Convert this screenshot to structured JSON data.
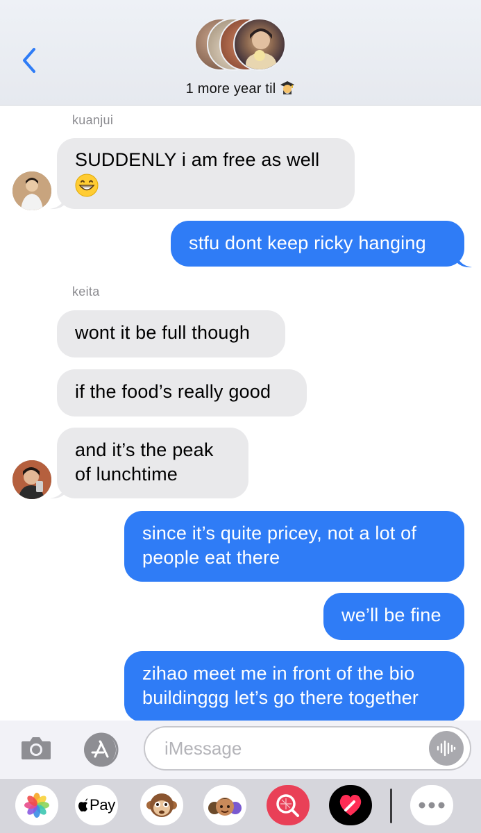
{
  "header": {
    "back_icon": "chevron-left-icon",
    "group_name": "1 more year til",
    "group_emoji": "student-emoji"
  },
  "messages": [
    {
      "sender": "kuanjui",
      "lines": [
        "SUDDENLY i am free as well",
        "😁"
      ],
      "direction": "incoming"
    },
    {
      "lines": [
        "stfu dont keep ricky hanging"
      ],
      "direction": "outgoing"
    },
    {
      "sender": "keita",
      "lines": [
        "wont it be full though"
      ],
      "direction": "incoming"
    },
    {
      "lines": [
        "if the food’s really good"
      ],
      "direction": "incoming"
    },
    {
      "lines": [
        "and it’s the peak",
        "of lunchtime"
      ],
      "direction": "incoming"
    },
    {
      "lines": [
        "since it’s quite pricey, not a lot of",
        "people eat there"
      ],
      "direction": "outgoing"
    },
    {
      "lines": [
        "we’ll be fine"
      ],
      "direction": "outgoing"
    },
    {
      "lines": [
        "zihao meet me in front of the bio",
        "buildinggg let’s go there together"
      ],
      "direction": "outgoing"
    }
  ],
  "compose": {
    "placeholder": "iMessage",
    "camera_icon": "camera-icon",
    "apps_icon": "app-store-icon",
    "audio_icon": "waveform-icon"
  },
  "drawer": {
    "pay_label": "Pay",
    "apps": [
      "photos-icon",
      "apple-pay-icon",
      "monkey-memoji-icon",
      "memoji-stickers-icon",
      "image-search-icon",
      "digital-touch-icon",
      "more-icon"
    ]
  },
  "colors": {
    "outgoing_bubble": "#2f7cf6",
    "incoming_bubble": "#e9e9eb",
    "header_bg": "#eef1f6"
  }
}
